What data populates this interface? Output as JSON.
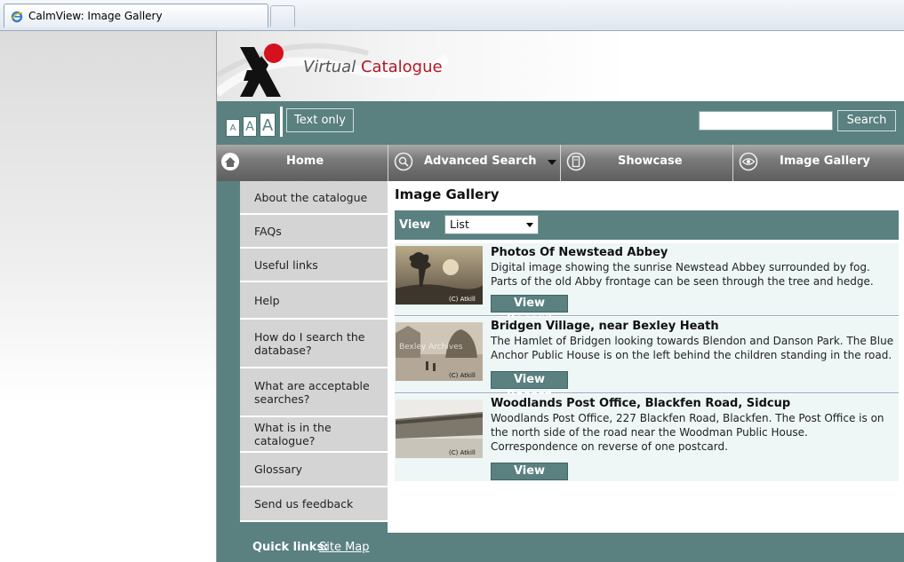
{
  "browser": {
    "tab_title": "CalmView: Image Gallery"
  },
  "brand": {
    "word1": "Virtual",
    "word2": "Catalogue"
  },
  "toolbar": {
    "font_small": "A",
    "font_medium": "A",
    "font_large": "A",
    "text_only": "Text only",
    "search_value": "",
    "search_button": "Search"
  },
  "nav": [
    {
      "label": "Home",
      "icon": "home-icon"
    },
    {
      "label": "Advanced Search",
      "icon": "magnifier-icon"
    },
    {
      "label": "Showcase",
      "icon": "page-icon"
    },
    {
      "label": "Image Gallery",
      "icon": "eye-icon"
    }
  ],
  "sidebar": [
    {
      "label": "About the catalogue"
    },
    {
      "label": "FAQs"
    },
    {
      "label": "Useful links"
    },
    {
      "label": "Help"
    },
    {
      "label": "How do I search the database?"
    },
    {
      "label": "What are acceptable searches?"
    },
    {
      "label": "What is in the catalogue?"
    },
    {
      "label": "Glossary"
    },
    {
      "label": "Send us feedback"
    }
  ],
  "content": {
    "title": "Image Gallery",
    "view_label": "View",
    "view_selected": "List"
  },
  "records": [
    {
      "title": "Photos Of Newstead Abbey",
      "description": "Digital image showing the sunrise Newstead Abbey surrounded by fog. Parts of the old Abby frontage can be seen through the tree and hedge.",
      "button": "View Record",
      "watermark": "(C) Atkill"
    },
    {
      "title": "Bridgen Village, near Bexley Heath",
      "description": "The Hamlet of Bridgen looking towards Blendon and Danson Park. The Blue Anchor Public House is on the left behind the children standing in the road.",
      "button": "View Record",
      "watermark": "(C) Atkill"
    },
    {
      "title": "Woodlands Post Office, Blackfen Road, Sidcup",
      "description": "Woodlands Post Office, 227 Blackfen Road, Blackfen. The Post Office is on the north side of the road near the Woodman Public House. Correspondence on reverse of one postcard.",
      "button": "View Record",
      "watermark": "(C) Atkill"
    }
  ],
  "footer": {
    "quick_links": "Quick links:",
    "site_map": "Site Map"
  }
}
